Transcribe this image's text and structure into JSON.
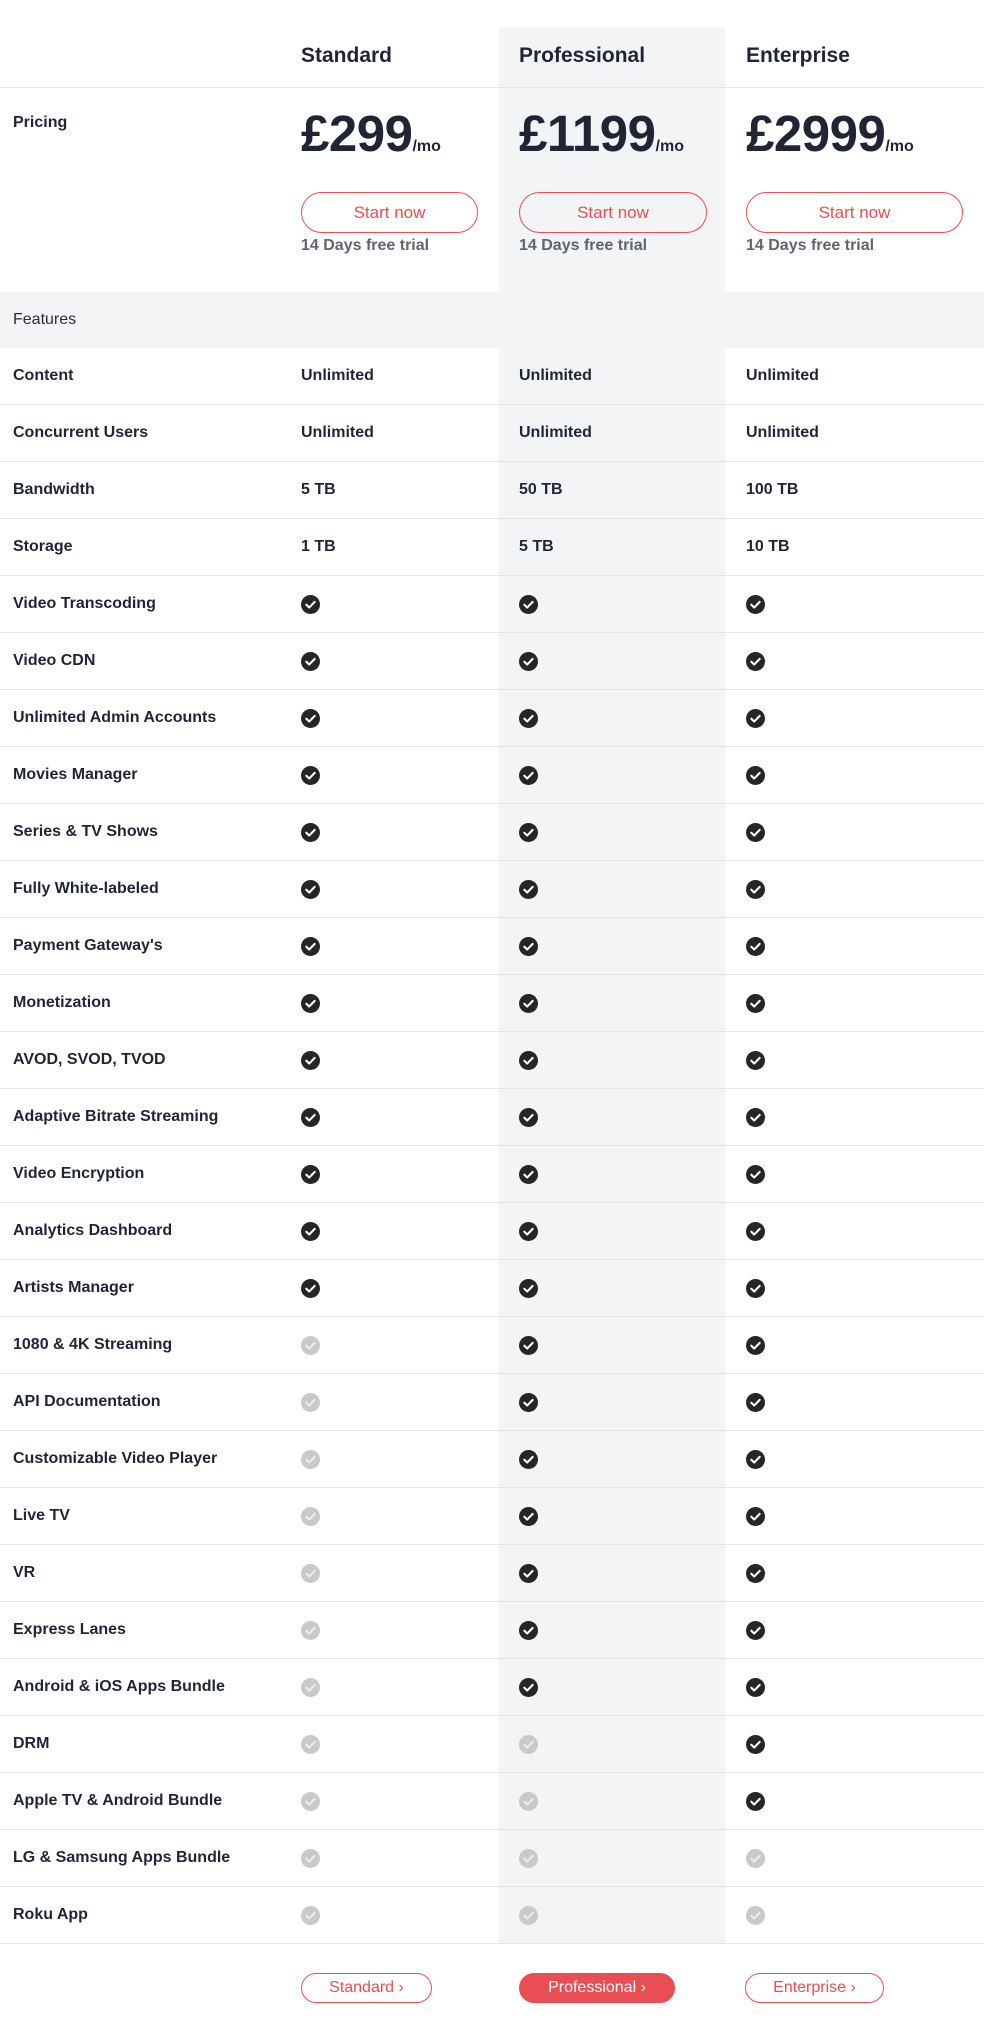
{
  "colors": {
    "accent": "#e94e55",
    "text": "#1f2535",
    "muted": "#5f6470",
    "highlight_bg": "#f3f4f6",
    "check_on": "#262626",
    "check_off": "#c9c9c9"
  },
  "plans": [
    {
      "name": "Standard",
      "price": "£299",
      "per": "/mo",
      "cta": "Start now",
      "trial": "14 Days free trial",
      "bottom_cta": "Standard ›"
    },
    {
      "name": "Professional",
      "price": "£1199",
      "per": "/mo",
      "cta": "Start now",
      "trial": "14 Days free trial",
      "bottom_cta": "Professional ›"
    },
    {
      "name": "Enterprise",
      "price": "£2999",
      "per": "/mo",
      "cta": "Start now",
      "trial": "14 Days free trial",
      "bottom_cta": "Enterprise ›"
    }
  ],
  "pricing_label": "Pricing",
  "features_label": "Features",
  "features": [
    {
      "name": "Content",
      "values": [
        "Unlimited",
        "Unlimited",
        "Unlimited"
      ]
    },
    {
      "name": "Concurrent Users",
      "values": [
        "Unlimited",
        "Unlimited",
        "Unlimited"
      ]
    },
    {
      "name": "Bandwidth",
      "values": [
        "5 TB",
        "50 TB",
        "100 TB"
      ]
    },
    {
      "name": "Storage",
      "values": [
        "1 TB",
        "5 TB",
        "10 TB"
      ]
    },
    {
      "name": "Video Transcoding",
      "values": [
        true,
        true,
        true
      ]
    },
    {
      "name": "Video CDN",
      "values": [
        true,
        true,
        true
      ]
    },
    {
      "name": "Unlimited Admin Accounts",
      "values": [
        true,
        true,
        true
      ]
    },
    {
      "name": "Movies Manager",
      "values": [
        true,
        true,
        true
      ]
    },
    {
      "name": "Series & TV Shows",
      "values": [
        true,
        true,
        true
      ]
    },
    {
      "name": "Fully White-labeled",
      "values": [
        true,
        true,
        true
      ]
    },
    {
      "name": "Payment Gateway's",
      "values": [
        true,
        true,
        true
      ]
    },
    {
      "name": "Monetization",
      "values": [
        true,
        true,
        true
      ]
    },
    {
      "name": "AVOD, SVOD, TVOD",
      "values": [
        true,
        true,
        true
      ]
    },
    {
      "name": "Adaptive Bitrate Streaming",
      "values": [
        true,
        true,
        true
      ]
    },
    {
      "name": "Video Encryption",
      "values": [
        true,
        true,
        true
      ]
    },
    {
      "name": "Analytics Dashboard",
      "values": [
        true,
        true,
        true
      ]
    },
    {
      "name": "Artists Manager",
      "values": [
        true,
        true,
        true
      ]
    },
    {
      "name": "1080 & 4K Streaming",
      "values": [
        false,
        true,
        true
      ]
    },
    {
      "name": "API Documentation",
      "values": [
        false,
        true,
        true
      ]
    },
    {
      "name": "Customizable Video Player",
      "values": [
        false,
        true,
        true
      ]
    },
    {
      "name": "Live TV",
      "values": [
        false,
        true,
        true
      ]
    },
    {
      "name": "VR",
      "values": [
        false,
        true,
        true
      ]
    },
    {
      "name": "Express Lanes",
      "values": [
        false,
        true,
        true
      ]
    },
    {
      "name": "Android & iOS Apps Bundle",
      "values": [
        false,
        true,
        true
      ]
    },
    {
      "name": "DRM",
      "values": [
        false,
        false,
        true
      ]
    },
    {
      "name": "Apple TV & Android Bundle",
      "values": [
        false,
        false,
        true
      ]
    },
    {
      "name": "LG & Samsung Apps Bundle",
      "values": [
        false,
        false,
        false
      ]
    },
    {
      "name": "Roku App",
      "values": [
        false,
        false,
        false
      ]
    }
  ],
  "icons": {
    "included": "check-circle-icon",
    "excluded": "check-circle-disabled-icon"
  }
}
